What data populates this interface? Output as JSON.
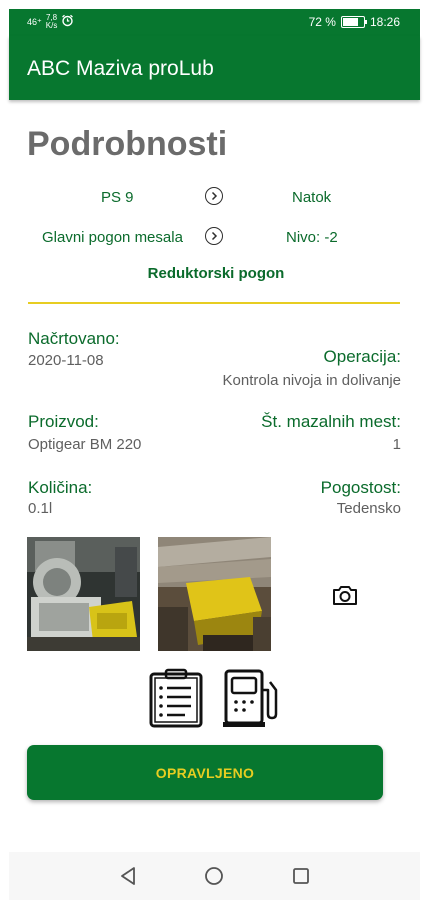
{
  "status_bar": {
    "network": "46⁺",
    "speed_value": "7,8",
    "speed_unit": "K/s",
    "battery": "72 %",
    "time": "18:26",
    "alarm_icon": "alarm-clock-icon",
    "battery_icon": "battery-icon"
  },
  "app": {
    "title": "ABC Maziva proLub",
    "brand_color": "#07772f",
    "accent_color": "#e7cd21"
  },
  "page": {
    "title": "Podrobnosti"
  },
  "route": {
    "row1": {
      "left": "PS 9",
      "right": "Natok"
    },
    "row2": {
      "left": "Glavni pogon mesala",
      "right": "Nivo: -2"
    },
    "subtitle": "Reduktorski pogon",
    "chevron_icon": "chevron-right-circle-icon"
  },
  "details": {
    "planned_label": "Načrtovano:",
    "planned_value": "2020-11-08",
    "operation_label": "Operacija:",
    "operation_value": "Kontrola nivoja in dolivanje",
    "product_label": "Proizvod:",
    "product_value": "Optigear BM 220",
    "points_label": "Št. mazalnih mest:",
    "points_value": "1",
    "quantity_label": "Količina:",
    "quantity_value": "0.1l",
    "frequency_label": "Pogostost:",
    "frequency_value": "Tedensko"
  },
  "photos": {
    "items": [
      "machine-photo-1",
      "machine-photo-2"
    ],
    "camera_icon": "camera-icon"
  },
  "actions": {
    "notes_icon": "clipboard-icon",
    "fuel_icon": "fuel-pump-icon",
    "done_label": "OPRAVLJENO"
  },
  "nav": {
    "back_icon": "back-triangle-icon",
    "home_icon": "home-circle-icon",
    "recents_icon": "recents-square-icon"
  }
}
